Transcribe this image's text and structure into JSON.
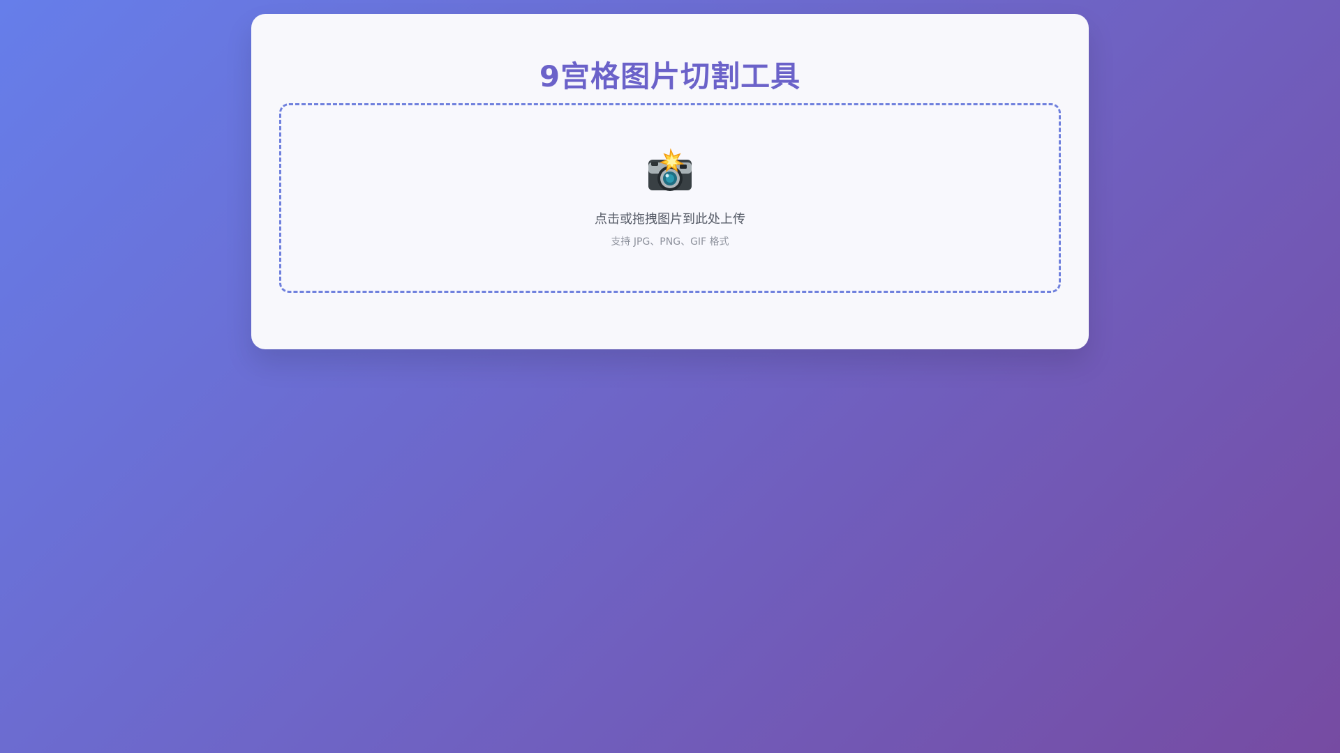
{
  "app": {
    "title": "9宫格图片切割工具"
  },
  "upload": {
    "icon": "camera-flash-icon",
    "prompt": "点击或拖拽图片到此处上传",
    "hint": "支持 JPG、PNG、GIF 格式"
  },
  "colors": {
    "background_start": "#667eea",
    "background_end": "#764ba2",
    "title": "#6b62c9",
    "upload_border": "#6f80dd"
  }
}
